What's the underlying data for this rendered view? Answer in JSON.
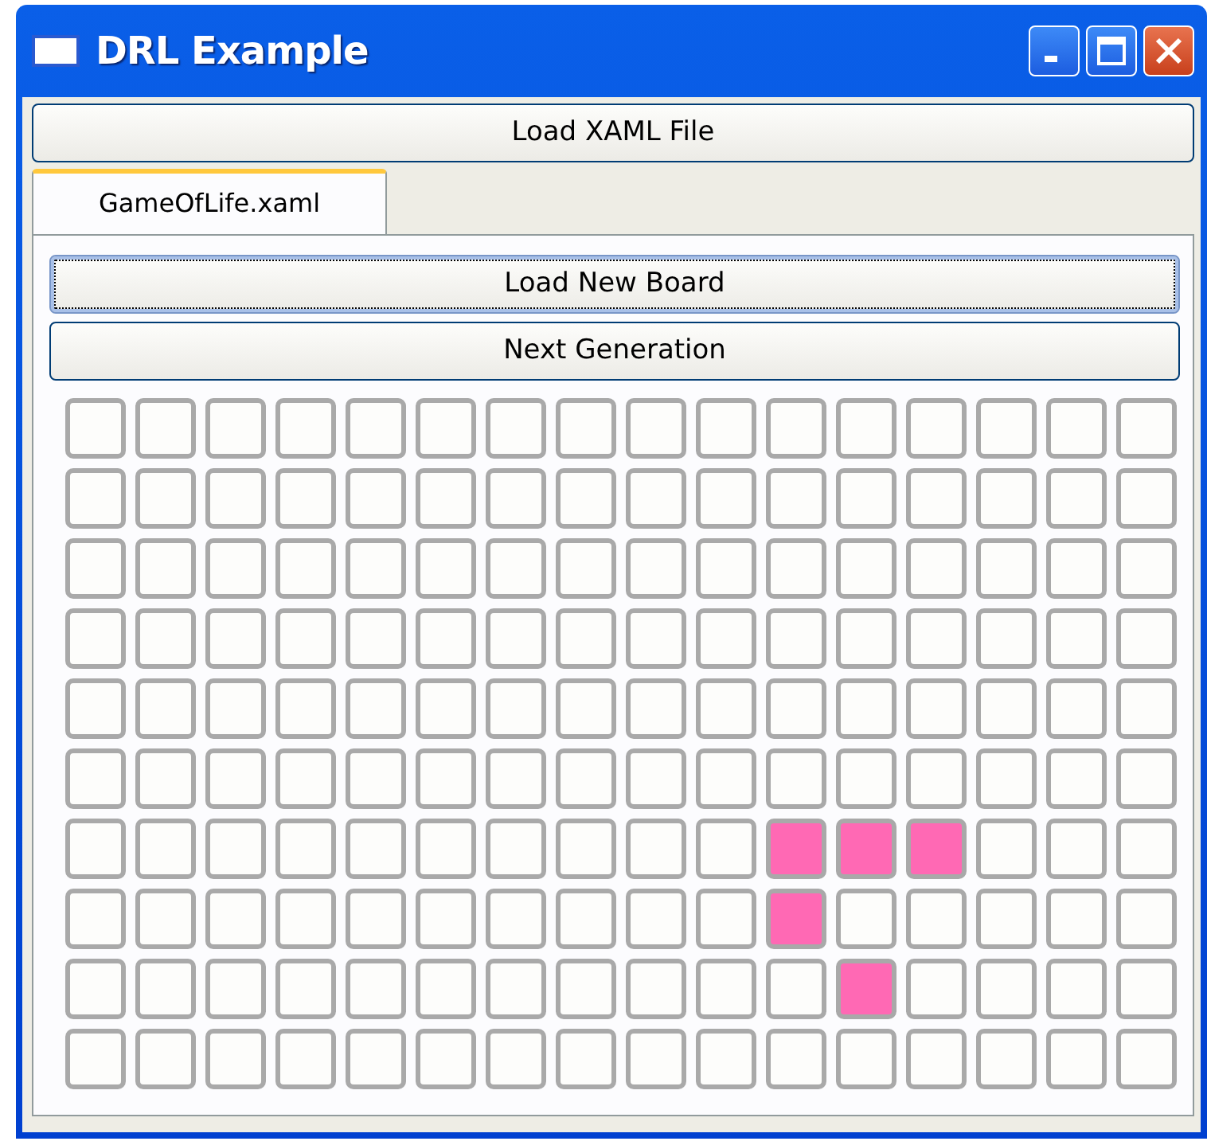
{
  "window": {
    "title": "DRL Example"
  },
  "load_button": "Load XAML File",
  "tabs": [
    {
      "label": "GameOfLife.xaml",
      "selected": true
    }
  ],
  "buttons": [
    {
      "label": "Load New Board",
      "focused": true
    },
    {
      "label": "Next Generation",
      "focused": false
    }
  ],
  "board": {
    "rows": [
      [
        false,
        false,
        false,
        false,
        false,
        false,
        false,
        false,
        false,
        false,
        false,
        false,
        false,
        false,
        false,
        false
      ],
      [
        false,
        false,
        false,
        false,
        false,
        false,
        false,
        false,
        false,
        false,
        false,
        false,
        false,
        false,
        false,
        false
      ],
      [
        false,
        false,
        false,
        false,
        false,
        false,
        false,
        false,
        false,
        false,
        false,
        false,
        false,
        false,
        false,
        false
      ],
      [
        false,
        false,
        false,
        false,
        false,
        false,
        false,
        false,
        false,
        false,
        false,
        false,
        false,
        false,
        false,
        false
      ],
      [
        false,
        false,
        false,
        false,
        false,
        false,
        false,
        false,
        false,
        false,
        false,
        false,
        false,
        false,
        false,
        false
      ],
      [
        false,
        false,
        false,
        false,
        false,
        false,
        false,
        false,
        false,
        false,
        false,
        false,
        false,
        false,
        false,
        false
      ],
      [
        false,
        false,
        false,
        false,
        false,
        false,
        false,
        false,
        false,
        false,
        true,
        true,
        true,
        false,
        false,
        false
      ],
      [
        false,
        false,
        false,
        false,
        false,
        false,
        false,
        false,
        false,
        false,
        true,
        false,
        false,
        false,
        false,
        false
      ],
      [
        false,
        false,
        false,
        false,
        false,
        false,
        false,
        false,
        false,
        false,
        false,
        true,
        false,
        false,
        false,
        false
      ],
      [
        false,
        false,
        false,
        false,
        false,
        false,
        false,
        false,
        false,
        false,
        false,
        false,
        false,
        false,
        false,
        false
      ]
    ]
  }
}
